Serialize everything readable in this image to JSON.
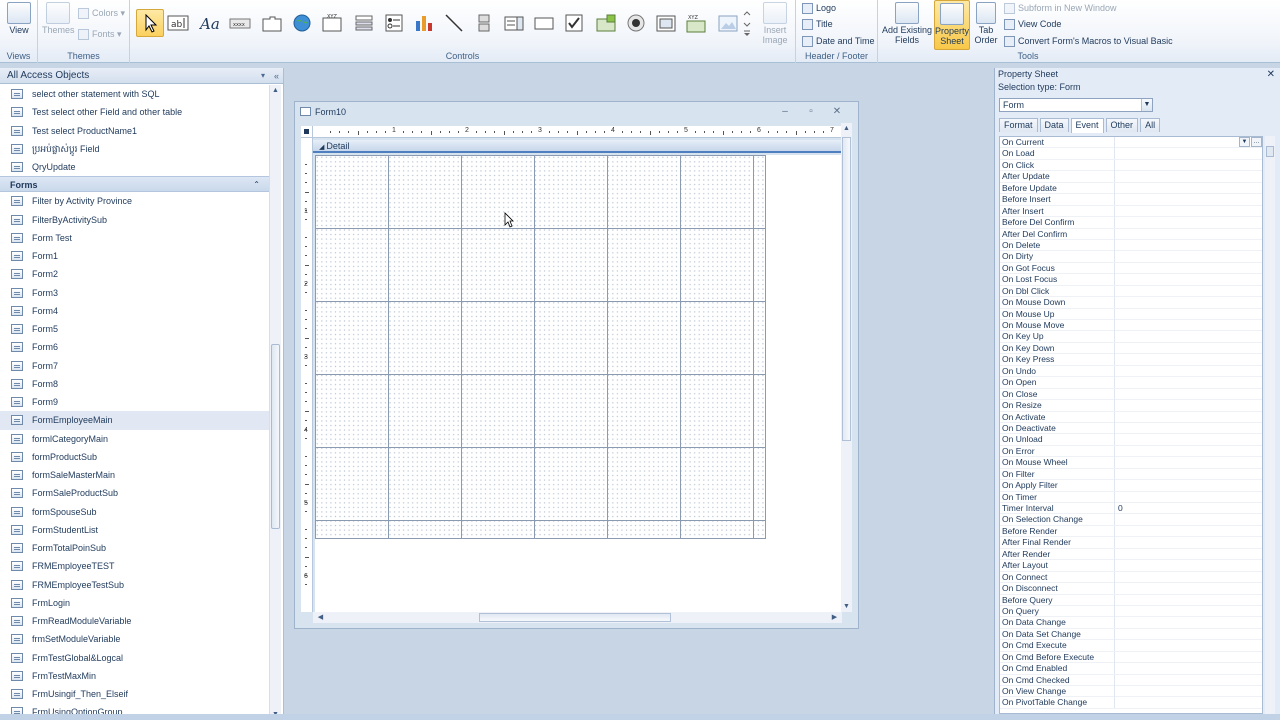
{
  "ribbon": {
    "views": {
      "button": "View",
      "group": "Views"
    },
    "themes": {
      "themes": "Themes",
      "colors": "Colors",
      "fonts": "Fonts",
      "group": "Themes"
    },
    "controls": {
      "group": "Controls",
      "insert_image": "Insert\nImage"
    },
    "header_footer": {
      "logo": "Logo",
      "title": "Title",
      "date_time": "Date and Time",
      "group": "Header / Footer"
    },
    "tools": {
      "add_existing_fields": "Add Existing\nFields",
      "property_sheet": "Property\nSheet",
      "tab_order": "Tab\nOrder",
      "subform_new_window": "Subform in New Window",
      "view_code": "View Code",
      "convert_macros": "Convert Form's Macros to Visual Basic",
      "group": "Tools"
    }
  },
  "nav": {
    "header": "All Access Objects",
    "queries": [
      "select other statement with SQL",
      "Test select other Field and other table",
      "Test select ProductName1",
      "ប្រអប់ផ្លាស់ប្តូរ Field",
      "QryUpdate"
    ],
    "forms_label": "Forms",
    "forms": [
      "Filter by Activity Province",
      "FilterByActivitySub",
      "Form Test",
      "Form1",
      "Form2",
      "Form3",
      "Form4",
      "Form5",
      "Form6",
      "Form7",
      "Form8",
      "Form9",
      "FormEmployeeMain",
      "formlCategoryMain",
      "formProductSub",
      "formSaleMasterMain",
      "FormSaleProductSub",
      "formSpouseSub",
      "FormStudentList",
      "FormTotalPoinSub",
      "FRMEmployeeTEST",
      "FRMEmployeeTestSub",
      "FrmLogin",
      "FrmReadModuleVariable",
      "frmSetModuleVariable",
      "FrmTestGlobal&Logcal",
      "FrmTestMaxMin",
      "FrmUsingif_Then_Elseif",
      "FrmUsingOptionGroup"
    ],
    "selected_form": "FormEmployeeMain"
  },
  "form_window": {
    "title": "Form10",
    "section": "Detail",
    "ruler_h": [
      "1",
      "2",
      "3",
      "4",
      "5",
      "6",
      "7"
    ],
    "ruler_v": [
      "1",
      "2",
      "3",
      "4",
      "5",
      "6"
    ]
  },
  "property_sheet": {
    "title": "Property Sheet",
    "selection_type": "Selection type:  Form",
    "selected_object": "Form",
    "tabs": [
      "Format",
      "Data",
      "Event",
      "Other",
      "All"
    ],
    "active_tab": "Event",
    "rows": [
      {
        "name": "On Current",
        "value": ""
      },
      {
        "name": "On Load",
        "value": ""
      },
      {
        "name": "On Click",
        "value": ""
      },
      {
        "name": "After Update",
        "value": ""
      },
      {
        "name": "Before Update",
        "value": ""
      },
      {
        "name": "Before Insert",
        "value": ""
      },
      {
        "name": "After Insert",
        "value": ""
      },
      {
        "name": "Before Del Confirm",
        "value": ""
      },
      {
        "name": "After Del Confirm",
        "value": ""
      },
      {
        "name": "On Delete",
        "value": ""
      },
      {
        "name": "On Dirty",
        "value": ""
      },
      {
        "name": "On Got Focus",
        "value": ""
      },
      {
        "name": "On Lost Focus",
        "value": ""
      },
      {
        "name": "On Dbl Click",
        "value": ""
      },
      {
        "name": "On Mouse Down",
        "value": ""
      },
      {
        "name": "On Mouse Up",
        "value": ""
      },
      {
        "name": "On Mouse Move",
        "value": ""
      },
      {
        "name": "On Key Up",
        "value": ""
      },
      {
        "name": "On Key Down",
        "value": ""
      },
      {
        "name": "On Key Press",
        "value": ""
      },
      {
        "name": "On Undo",
        "value": ""
      },
      {
        "name": "On Open",
        "value": ""
      },
      {
        "name": "On Close",
        "value": ""
      },
      {
        "name": "On Resize",
        "value": ""
      },
      {
        "name": "On Activate",
        "value": ""
      },
      {
        "name": "On Deactivate",
        "value": ""
      },
      {
        "name": "On Unload",
        "value": ""
      },
      {
        "name": "On Error",
        "value": ""
      },
      {
        "name": "On Mouse Wheel",
        "value": ""
      },
      {
        "name": "On Filter",
        "value": ""
      },
      {
        "name": "On Apply Filter",
        "value": ""
      },
      {
        "name": "On Timer",
        "value": ""
      },
      {
        "name": "Timer Interval",
        "value": "0"
      },
      {
        "name": "On Selection Change",
        "value": ""
      },
      {
        "name": "Before Render",
        "value": ""
      },
      {
        "name": "After Final Render",
        "value": ""
      },
      {
        "name": "After Render",
        "value": ""
      },
      {
        "name": "After Layout",
        "value": ""
      },
      {
        "name": "On Connect",
        "value": ""
      },
      {
        "name": "On Disconnect",
        "value": ""
      },
      {
        "name": "Before Query",
        "value": ""
      },
      {
        "name": "On Query",
        "value": ""
      },
      {
        "name": "On Data Change",
        "value": ""
      },
      {
        "name": "On Data Set Change",
        "value": ""
      },
      {
        "name": "On Cmd Execute",
        "value": ""
      },
      {
        "name": "On Cmd Before Execute",
        "value": ""
      },
      {
        "name": "On Cmd Enabled",
        "value": ""
      },
      {
        "name": "On Cmd Checked",
        "value": ""
      },
      {
        "name": "On View Change",
        "value": ""
      },
      {
        "name": "On PivotTable Change",
        "value": ""
      }
    ]
  },
  "colors": {
    "ribbon_bg": "#f0f4fa",
    "accent_selected": "#fbd05e",
    "workspace": "#c8d5e5",
    "pane_header": "#d3dfee"
  }
}
